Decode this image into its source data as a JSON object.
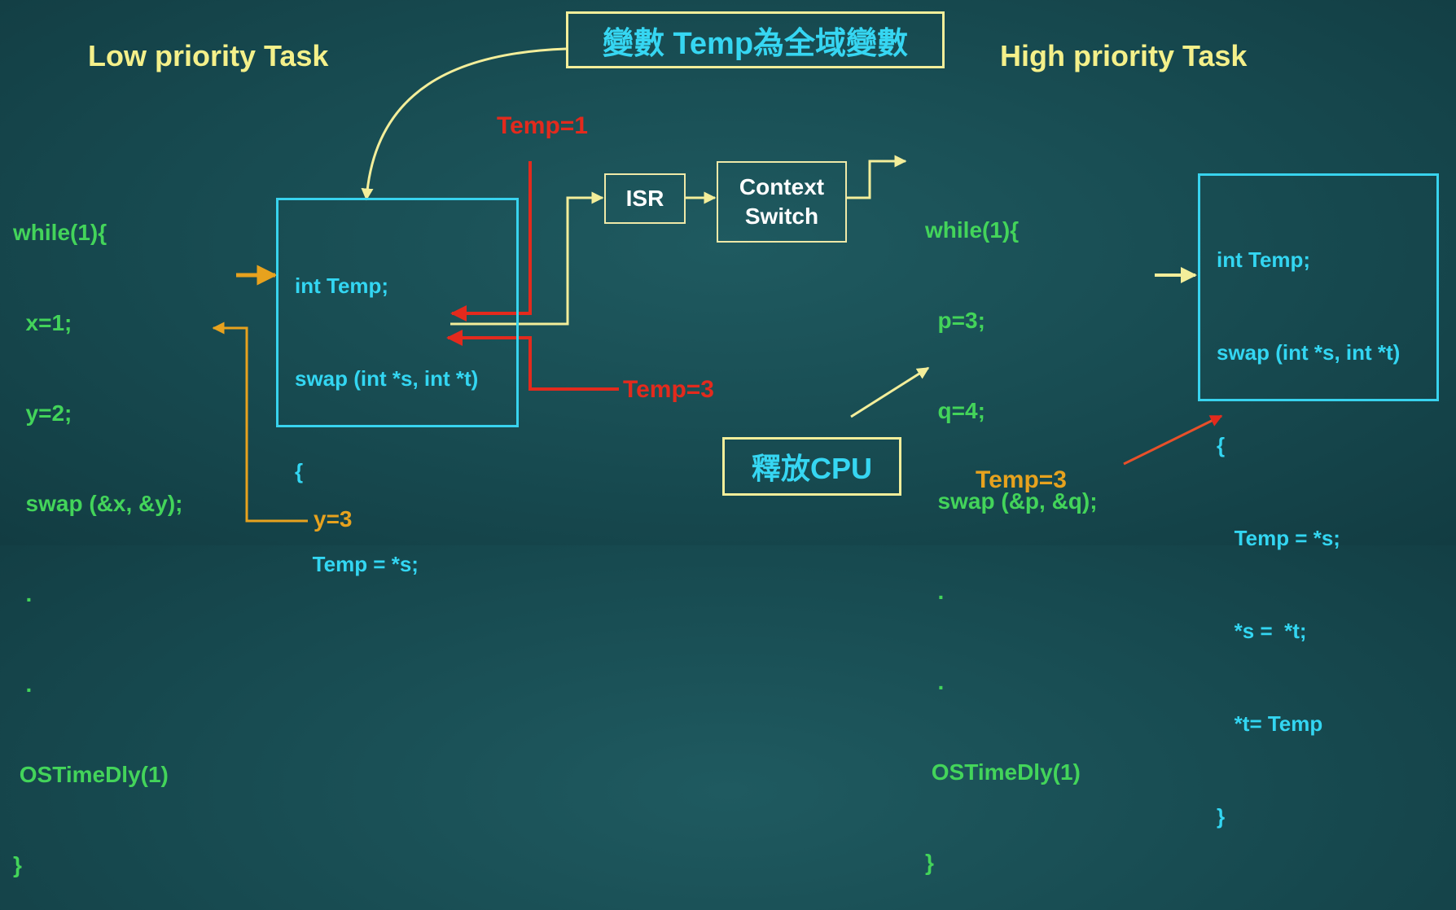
{
  "titles": {
    "low": "Low priority Task",
    "high": "High priority Task"
  },
  "callouts": {
    "global": "變數 Temp為全域變數",
    "release": "釋放CPU"
  },
  "low_task": {
    "lines": [
      "while(1){",
      "  x=1;",
      "  y=2;",
      "  swap (&x, &y);",
      "  .",
      "  .",
      " OSTimeDly(1)",
      "}"
    ]
  },
  "high_task": {
    "lines": [
      "while(1){",
      "  p=3;",
      "  q=4;",
      "  swap (&p, &q);",
      "  .",
      "  .",
      " OSTimeDly(1)",
      "}"
    ]
  },
  "swap_left": {
    "lines": [
      "int Temp;",
      "swap (int *s, int *t)",
      "{",
      "   Temp = *s;"
    ]
  },
  "swap_right": {
    "lines": [
      "int Temp;",
      "swap (int *s, int *t)",
      "{",
      "   Temp = *s;",
      "   *s =  *t;",
      "   *t= Temp",
      "}"
    ]
  },
  "flow": {
    "isr": "ISR",
    "context_switch": "Context\nSwitch"
  },
  "annotations": {
    "temp1": "Temp=1",
    "temp3_red": "Temp=3",
    "temp3_orange": "Temp=3",
    "y3": "y=3"
  },
  "colors": {
    "background": "#174a50",
    "title": "#f4f08a",
    "code_green": "#43d45a",
    "code_cyan": "#33d6f2",
    "red": "#e32a1d",
    "orange": "#e7a21e",
    "box_border_cyan": "#38d3ee",
    "box_border_yellow": "#efe9a8"
  }
}
